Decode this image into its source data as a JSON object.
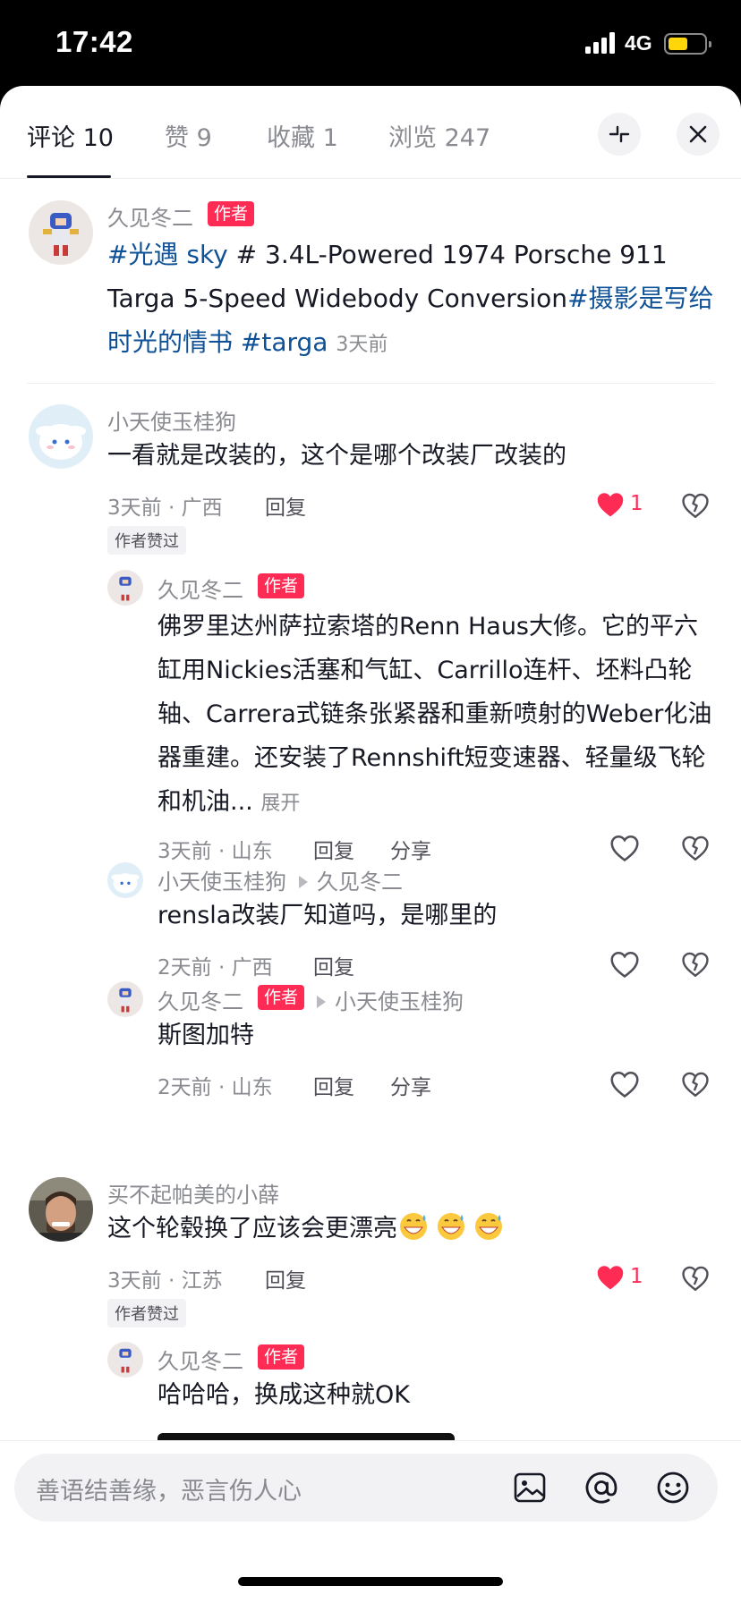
{
  "status": {
    "time": "17:42",
    "network": "4G"
  },
  "tabs": [
    {
      "label": "评论 10",
      "active": true
    },
    {
      "label": "赞 9"
    },
    {
      "label": "收藏 1"
    },
    {
      "label": "浏览 247"
    }
  ],
  "header_icons": {
    "collapse": "collapse-icon",
    "close": "close-icon"
  },
  "post": {
    "author": "久见冬二",
    "badge": "作者",
    "tag1": "#光遇 sky",
    "text1": " # 3.4L-Powered 1974 Porsche 911 Targa 5-Speed Widebody Conversion",
    "tag2": "#摄影是写给时光的情书",
    "tag3": " #targa",
    "time": "3天前"
  },
  "comments": [
    {
      "user": "小天使玉桂狗",
      "text": "一看就是改装的，这个是哪个改装厂改装的",
      "meta": "3天前 · 广西",
      "reply": "回复",
      "likes": "1",
      "liked_by_author": "作者赞过",
      "replies": [
        {
          "user": "久见冬二",
          "badge": "作者",
          "text": "佛罗里达州萨拉索塔的Renn Haus大修。它的平六缸用Nickies活塞和气缸、Carrillo连杆、坯料凸轮轴、Carrera式链条张紧器和重新喷射的Weber化油器重建。还安装了Rennshift短变速器、轻量级飞轮和机油...",
          "expand": "展开",
          "meta": "3天前 · 山东",
          "reply": "回复",
          "share": "分享"
        },
        {
          "user": "小天使玉桂狗",
          "reply_to": "久见冬二",
          "text": "rensla改装厂知道吗，是哪里的",
          "meta": "2天前 · 广西",
          "reply": "回复"
        },
        {
          "user": "久见冬二",
          "badge": "作者",
          "reply_to": "小天使玉桂狗",
          "text": "斯图加特",
          "meta": "2天前 · 山东",
          "reply": "回复",
          "share": "分享"
        }
      ]
    },
    {
      "user": "买不起帕美的小薛",
      "text": "这个轮毂换了应该会更漂亮",
      "emojis": [
        "grinning-sweat-emoji",
        "grinning-sweat-emoji",
        "grinning-sweat-emoji"
      ],
      "meta": "3天前 · 江苏",
      "reply": "回复",
      "likes": "1",
      "liked_by_author": "作者赞过",
      "replies": [
        {
          "user": "久见冬二",
          "badge": "作者",
          "text": "哈哈哈，换成这种就OK"
        }
      ]
    }
  ],
  "input": {
    "placeholder": "善语结善缘，恶言伤人心",
    "icons": [
      "image-icon",
      "at-icon",
      "emoji-icon"
    ]
  },
  "colors": {
    "accent": "#fe2c55",
    "hashtag": "#0e5197",
    "muted": "#8a8b91",
    "text": "#161823"
  }
}
